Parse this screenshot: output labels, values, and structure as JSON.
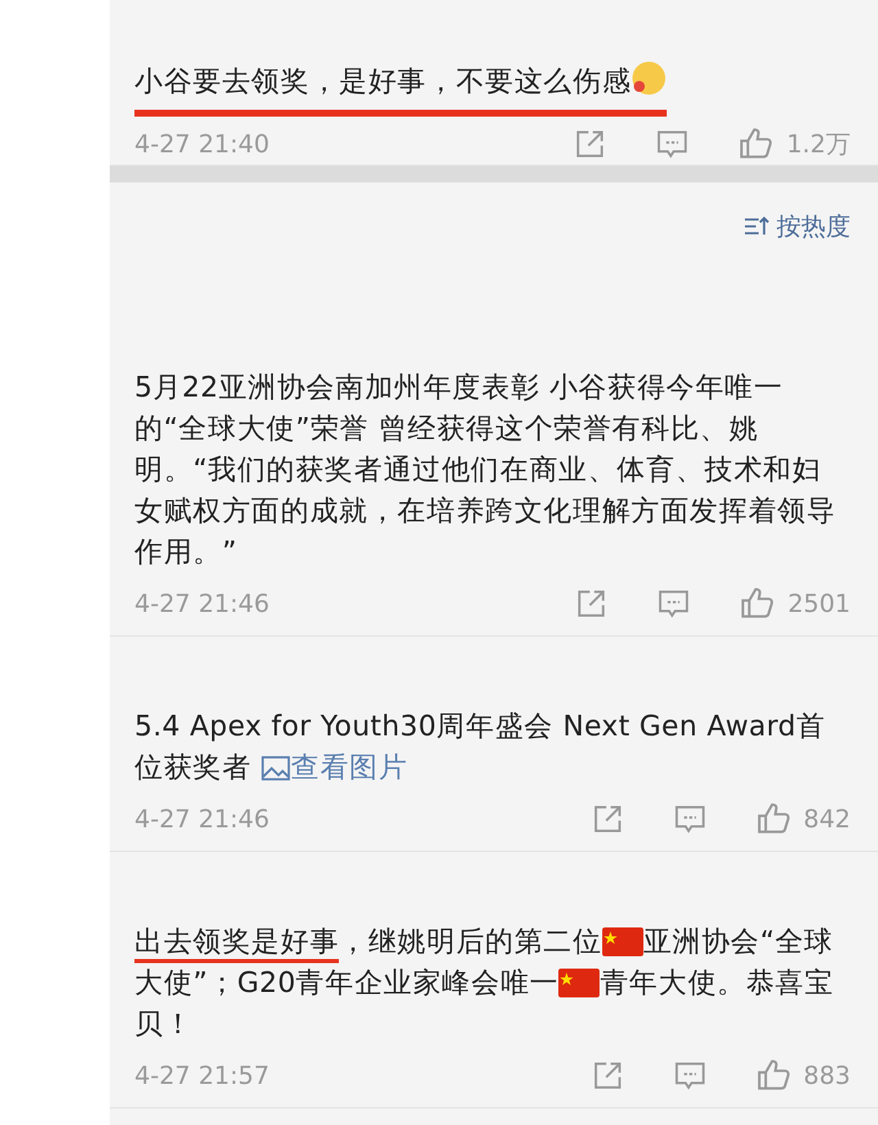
{
  "comments": [
    {
      "segments": [
        {
          "kind": "text",
          "text": "小谷要去领奖，是好事，不要这么伤感",
          "underlined": true
        },
        {
          "kind": "emoji",
          "underlined": true
        }
      ],
      "time": "4-27 21:40",
      "likes": "1.2万"
    },
    {
      "segments": [
        {
          "kind": "text",
          "text": "5月22亚洲协会南加州年度表彰 小谷获得今年唯一的“全球大使”荣誉 曾经获得这个荣誉有科比、姚明。“我们的获奖者通过他们在商业、体育、技术和妇女赋权方面的成就，在培养跨文化理解方面发挥着领导作用。”",
          "underlined": false
        }
      ],
      "time": "4-27 21:46",
      "likes": "2501"
    },
    {
      "segments": [
        {
          "kind": "text",
          "text": "5.4 Apex for Youth30周年盛会  Next Gen Award首位获奖者 ",
          "underlined": false
        },
        {
          "kind": "link",
          "text": "查看图片"
        }
      ],
      "time": "4-27 21:46",
      "likes": "842"
    },
    {
      "segments": [
        {
          "kind": "text",
          "text": "出去领奖是好事",
          "underlined": true
        },
        {
          "kind": "text",
          "text": "，继姚明后的第二位",
          "underlined": false
        },
        {
          "kind": "flag"
        },
        {
          "kind": "text",
          "text": "亚洲协会“全球大使”；G20青年企业家峰会唯一",
          "underlined": false
        },
        {
          "kind": "flag"
        },
        {
          "kind": "text",
          "text": "青年大使。恭喜宝贝！",
          "underlined": false
        }
      ],
      "time": "4-27 21:57",
      "likes": "883"
    }
  ],
  "sort": {
    "label": "按热度"
  }
}
